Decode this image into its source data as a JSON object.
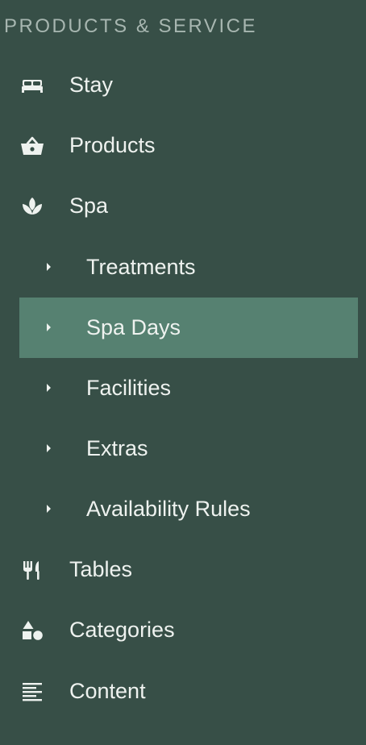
{
  "section": {
    "title": "PRODUCTS & SERVICE"
  },
  "nav": {
    "stay": {
      "label": "Stay",
      "icon": "bed-icon"
    },
    "products": {
      "label": "Products",
      "icon": "basket-icon"
    },
    "spa": {
      "label": "Spa",
      "icon": "lotus-icon",
      "children": [
        {
          "label": "Treatments"
        },
        {
          "label": "Spa Days",
          "active": true
        },
        {
          "label": "Facilities"
        },
        {
          "label": "Extras"
        },
        {
          "label": "Availability Rules"
        }
      ]
    },
    "tables": {
      "label": "Tables",
      "icon": "utensils-icon"
    },
    "categories": {
      "label": "Categories",
      "icon": "shapes-icon"
    },
    "content": {
      "label": "Content",
      "icon": "text-lines-icon"
    }
  },
  "colors": {
    "background": "#374f47",
    "active_background": "#568171",
    "text": "#eef2ef",
    "section_title": "#a7b6b0"
  }
}
